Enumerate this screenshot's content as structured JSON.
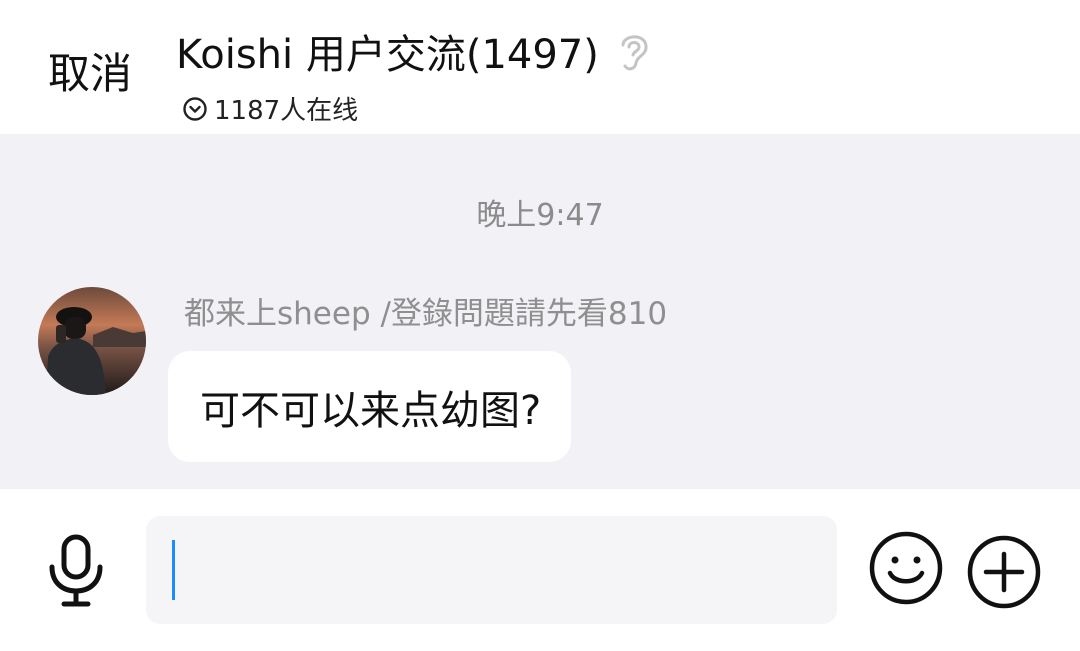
{
  "header": {
    "cancel_label": "取消",
    "title": "Koishi 用户交流(1497)",
    "online_text": "1187人在线"
  },
  "chat": {
    "timestamp": "晚上9:47",
    "messages": [
      {
        "sender": "都来上sheep /登錄問題請先看810",
        "text": "可不可以来点幼图?"
      }
    ]
  },
  "input": {
    "value": ""
  },
  "icons": {
    "ear": "ear-icon",
    "online_toggle": "chevron-down-circle-icon",
    "mic": "microphone-icon",
    "emoji": "emoji-icon",
    "plus": "plus-circle-icon"
  },
  "colors": {
    "chat_background": "#f2f1f6",
    "caret": "#1a8cff"
  }
}
